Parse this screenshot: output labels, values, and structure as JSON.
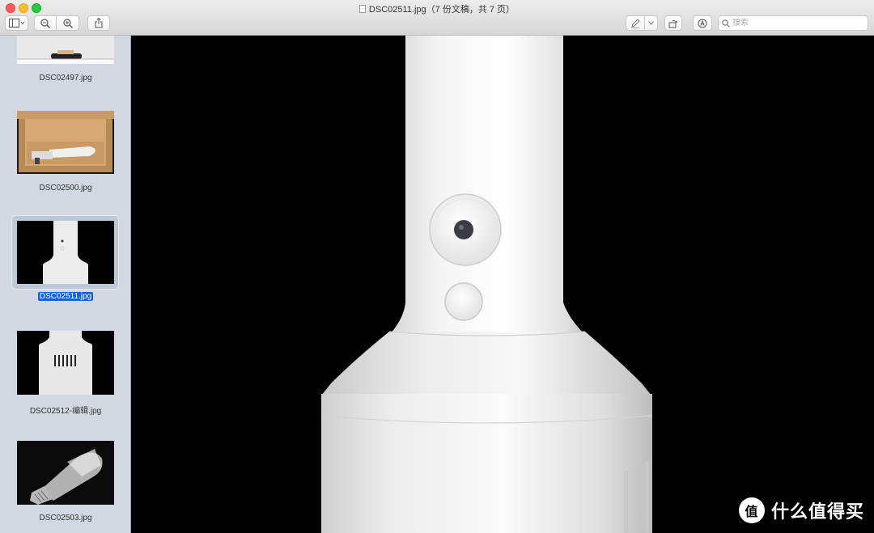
{
  "window": {
    "title": "DSC02511.jpg（7 份文稿，共 7 页）"
  },
  "toolbar": {
    "sidebar_icon": "sidebar-toggle-icon",
    "zoom_out_icon": "zoom-out-icon",
    "zoom_in_icon": "zoom-in-icon",
    "share_icon": "share-icon",
    "markup_icon": "markup-pen-icon",
    "rotate_icon": "rotate-icon",
    "annotate_icon": "annotate-icon"
  },
  "search": {
    "placeholder": "搜索"
  },
  "sidebar": {
    "items": [
      {
        "label": "DSC02497.jpg"
      },
      {
        "label": "DSC02500.jpg"
      },
      {
        "label": "DSC02511.jpg",
        "selected": true
      },
      {
        "label": "DSC02512-编辑.jpg"
      },
      {
        "label": "DSC02503.jpg"
      }
    ]
  },
  "watermark": {
    "logo_glyph": "值",
    "text": "什么值得买"
  }
}
